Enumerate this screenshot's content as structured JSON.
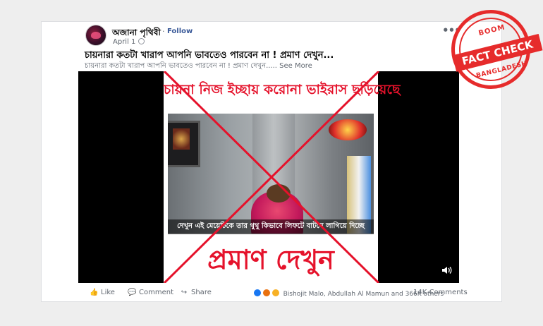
{
  "post": {
    "page_name": "অজানা পৃথিবী",
    "follow_label": "Follow",
    "date": "April 1",
    "headline": "চায়নারা কতটা খারাপ আপনি ভাবতেও পারবেন না ! প্রমাণ দেখুন...",
    "text": "চায়নারা কতটা খারাপ আপনি ভাবতেও পারবেন না ! প্রমাণ দেখুন.....",
    "see_more": "See More"
  },
  "video": {
    "caption_top": "চায়না নিজ ইচ্ছায় করোনা ভাইরাস ছড়িয়েছে",
    "caption_middle": "দেখুন এই মেয়েটিকে তার থুথু কিভাবে লিফটে বাটনে লাগিয়ে দিচ্ছে",
    "caption_bottom": "প্রমাণ দেখুন",
    "cross_color": "#e5122b"
  },
  "actions": {
    "like": "Like",
    "comment": "Comment",
    "share": "Share"
  },
  "reactions": {
    "summary": "Bishojit Malo, Abdullah Al Mamun and 366K others",
    "comments": "14K Comments"
  },
  "stamp": {
    "top": "BOOM",
    "band": "FACT CHECK",
    "bottom": "BANGLADESH",
    "color": "#e62b2b"
  },
  "icons": [
    "more-dots-icon",
    "globe-icon",
    "volume-icon",
    "like-icon",
    "comment-icon",
    "share-icon"
  ]
}
